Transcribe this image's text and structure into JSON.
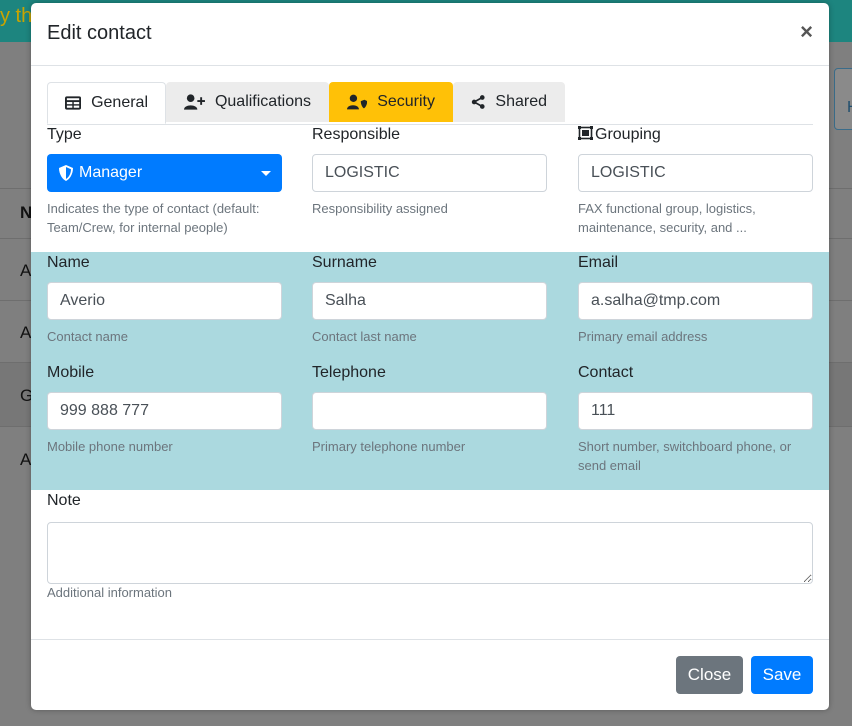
{
  "background": {
    "top_text": "y th",
    "rows": [
      "N",
      "A",
      "A",
      "G",
      "A"
    ],
    "side_button_text": "H"
  },
  "modal": {
    "title": "Edit contact",
    "close_symbol": "×",
    "tabs": [
      {
        "label": "General",
        "icon": "table-icon"
      },
      {
        "label": "Qualifications",
        "icon": "user-plus-icon"
      },
      {
        "label": "Security",
        "icon": "user-shield-icon"
      },
      {
        "label": "Shared",
        "icon": "share-icon"
      }
    ],
    "type": {
      "label": "Type",
      "value": "Manager",
      "help": "Indicates the type of contact (default: Team/Crew, for internal people)"
    },
    "responsible": {
      "label": "Responsible",
      "value": "LOGISTIC",
      "help": "Responsibility assigned"
    },
    "grouping": {
      "label": "Grouping",
      "value": "LOGISTIC",
      "help": "FAX functional group, logistics, maintenance, security, and ..."
    },
    "name": {
      "label": "Name",
      "value": "Averio",
      "help": "Contact name"
    },
    "surname": {
      "label": "Surname",
      "value": "Salha",
      "help": "Contact last name"
    },
    "email": {
      "label": "Email",
      "value": "a.salha@tmp.com",
      "help": "Primary email address"
    },
    "mobile": {
      "label": "Mobile",
      "value": "999 888 777",
      "help": "Mobile phone number"
    },
    "telephone": {
      "label": "Telephone",
      "value": "",
      "help": "Primary telephone number"
    },
    "contact": {
      "label": "Contact",
      "value": "111",
      "help": "Short number, switchboard phone, or send email"
    },
    "note": {
      "label": "Note",
      "value": "",
      "help": "Additional information"
    },
    "buttons": {
      "close": "Close",
      "save": "Save"
    }
  },
  "colors": {
    "primary": "#007bff",
    "security_tab": "#ffc107",
    "teal_band": "#abd9df",
    "secondary": "#6c757d"
  }
}
